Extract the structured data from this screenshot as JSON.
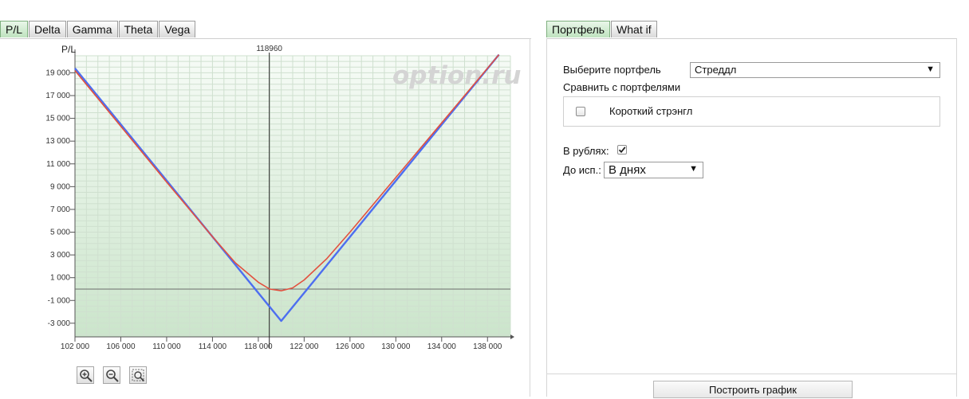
{
  "left_tabs": [
    "P/L",
    "Delta",
    "Gamma",
    "Theta",
    "Vega"
  ],
  "right_tabs": [
    "Портфель",
    "What if"
  ],
  "watermark": "option.ru",
  "zoom_icons": [
    "zoom-in-icon",
    "zoom-out-icon",
    "zoom-reset-icon"
  ],
  "form": {
    "portfolio_label": "Выберите портфель",
    "portfolio_value": "Стреддл",
    "compare_label": "Сравнить с портфелями",
    "compare_item": "Короткий стрэнгл",
    "compare_checked": false,
    "rubles_label": "В рублях:",
    "rubles_checked": true,
    "expiry_label": "До исп.:",
    "expiry_value": "В днях",
    "build_button": "Построить график"
  },
  "colors": {
    "accent_tab": "#bfe2bf",
    "plot_bg_top": "#f6fbf6",
    "plot_bg_bottom": "#cbe5cb",
    "line_blue": "#4d6ef0",
    "line_red": "#e2503f"
  },
  "chart_data": {
    "type": "line",
    "ylabel": "P/L",
    "marker_label": "118960",
    "marker_x": 118960,
    "xlim": [
      102000,
      140000
    ],
    "ylim": [
      -4200,
      20500
    ],
    "x_ticks": [
      102000,
      106000,
      110000,
      114000,
      118000,
      122000,
      126000,
      130000,
      134000,
      138000
    ],
    "x_tick_labels": [
      "102 000",
      "106 000",
      "110 000",
      "114 000",
      "118 000",
      "122 000",
      "126 000",
      "130 000",
      "134 000",
      "138 000"
    ],
    "y_ticks": [
      19000,
      17000,
      15000,
      13000,
      11000,
      9000,
      7000,
      5000,
      3000,
      1000,
      -1000,
      -3000
    ],
    "y_tick_labels": [
      "19 000",
      "17 000",
      "15 000",
      "13 000",
      "11 000",
      "9 000",
      "7 000",
      "5 000",
      "3 000",
      "1 000",
      "-1 000",
      "-3 000"
    ],
    "zero_line": 0,
    "series": [
      {
        "color": "#4d6ef0",
        "x": [
          102000,
          120000,
          139000
        ],
        "y": [
          19400,
          -2800,
          20600
        ]
      },
      {
        "color": "#e2503f",
        "x": [
          102000,
          106000,
          110000,
          114000,
          116000,
          118000,
          119000,
          120000,
          121000,
          122000,
          124000,
          126000,
          130000,
          134000,
          139000
        ],
        "y": [
          19200,
          14300,
          9400,
          4600,
          2300,
          600,
          0,
          -150,
          100,
          800,
          2700,
          5000,
          9800,
          14600,
          20600
        ]
      }
    ]
  }
}
